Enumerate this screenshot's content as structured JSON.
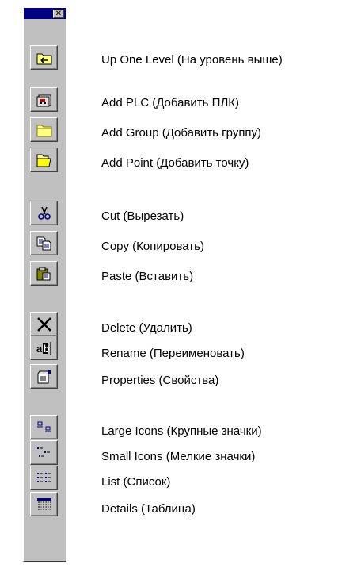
{
  "toolbar": {
    "close_glyph": "✕",
    "buttons": [
      {
        "icon": "up-one-level-icon"
      },
      {
        "icon": "add-plc-icon"
      },
      {
        "icon": "add-group-icon"
      },
      {
        "icon": "add-point-icon"
      },
      {
        "icon": "cut-icon"
      },
      {
        "icon": "copy-icon"
      },
      {
        "icon": "paste-icon"
      },
      {
        "icon": "delete-icon"
      },
      {
        "icon": "rename-icon"
      },
      {
        "icon": "properties-icon"
      },
      {
        "icon": "large-icons-icon"
      },
      {
        "icon": "small-icons-icon"
      },
      {
        "icon": "list-icon"
      },
      {
        "icon": "details-icon"
      }
    ]
  },
  "labels": [
    "Up One Level (На уровень выше)",
    "Add PLC (Добавить ПЛК)",
    "Add Group (Добавить группу)",
    "Add Point (Добавить точку)",
    "Cut (Вырезать)",
    "Copy (Копировать)",
    "Paste (Вставить)",
    "Delete (Удалить)",
    "Rename (Переименовать)",
    "Properties (Свойства)",
    "Large Icons (Крупные значки)",
    "Small Icons (Мелкие значки)",
    "List (Список)",
    "Details (Таблица)"
  ]
}
